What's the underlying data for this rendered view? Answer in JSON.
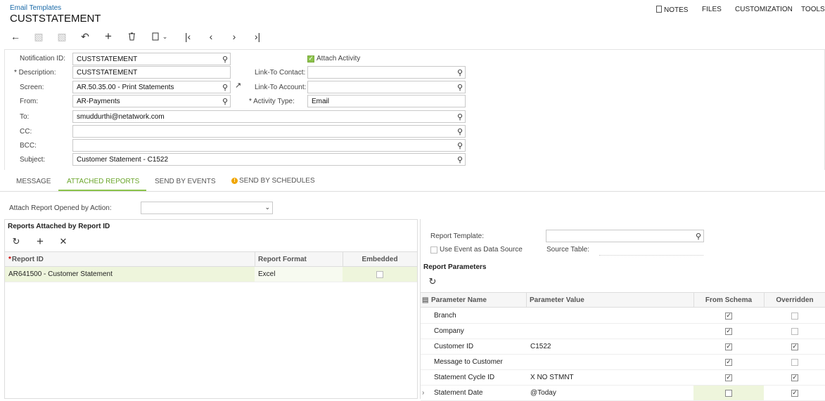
{
  "header": {
    "breadcrumb": "Email Templates",
    "title": "CUSTSTATEMENT",
    "menu": {
      "notes": "NOTES",
      "files": "FILES",
      "customization": "CUSTOMIZATION",
      "tools": "TOOLS"
    }
  },
  "form": {
    "notification_id": {
      "label": "Notification ID:",
      "value": "CUSTSTATEMENT"
    },
    "attach_activity": {
      "label": "Attach Activity",
      "checked": true
    },
    "description": {
      "label": "Description:",
      "value": "CUSTSTATEMENT"
    },
    "link_to_contact": {
      "label": "Link-To Contact:",
      "value": ""
    },
    "screen": {
      "label": "Screen:",
      "value": "AR.50.35.00 - Print Statements"
    },
    "link_to_account": {
      "label": "Link-To Account:",
      "value": ""
    },
    "from": {
      "label": "From:",
      "value": "AR-Payments"
    },
    "activity_type": {
      "label": "Activity Type:",
      "value": "Email"
    },
    "to": {
      "label": "To:",
      "value": "smuddurthi@netatwork.com"
    },
    "cc": {
      "label": "CC:",
      "value": ""
    },
    "bcc": {
      "label": "BCC:",
      "value": ""
    },
    "subject": {
      "label": "Subject:",
      "value": "Customer Statement - C1522"
    }
  },
  "tabs": {
    "message": "MESSAGE",
    "attached_reports": "ATTACHED REPORTS",
    "send_by_events": "SEND BY EVENTS",
    "send_by_schedules": "SEND BY SCHEDULES",
    "active": "attached_reports"
  },
  "attach_action": {
    "label": "Attach Report Opened by Action:",
    "value": ""
  },
  "reports": {
    "title": "Reports Attached by Report ID",
    "columns": {
      "report_id": "Report ID",
      "report_format": "Report Format",
      "embedded": "Embedded"
    },
    "rows": [
      {
        "report_id": "AR641500 - Customer Statement",
        "report_format": "Excel",
        "embedded": false
      }
    ]
  },
  "report_settings": {
    "template_label": "Report Template:",
    "template_value": "",
    "use_event_label": "Use Event as Data Source",
    "source_table_label": "Source Table:"
  },
  "parameters": {
    "title": "Report Parameters",
    "columns": {
      "name": "Parameter Name",
      "value": "Parameter Value",
      "from_schema": "From Schema",
      "overridden": "Overridden"
    },
    "rows": [
      {
        "name": "Branch",
        "value": "",
        "from_schema": true,
        "overridden": false
      },
      {
        "name": "Company",
        "value": "",
        "from_schema": true,
        "overridden": false
      },
      {
        "name": "Customer ID",
        "value": "C1522",
        "from_schema": true,
        "overridden": true
      },
      {
        "name": "Message to Customer",
        "value": "",
        "from_schema": true,
        "overridden": false
      },
      {
        "name": "Statement Cycle ID",
        "value": "X NO STMNT",
        "from_schema": true,
        "overridden": true
      },
      {
        "name": "Statement Date",
        "value": "@Today",
        "from_schema": false,
        "overridden": true
      }
    ]
  },
  "colors": {
    "accent": "#8bc34a",
    "link": "#1a6aa8",
    "selected_row": "#eef5dc"
  }
}
